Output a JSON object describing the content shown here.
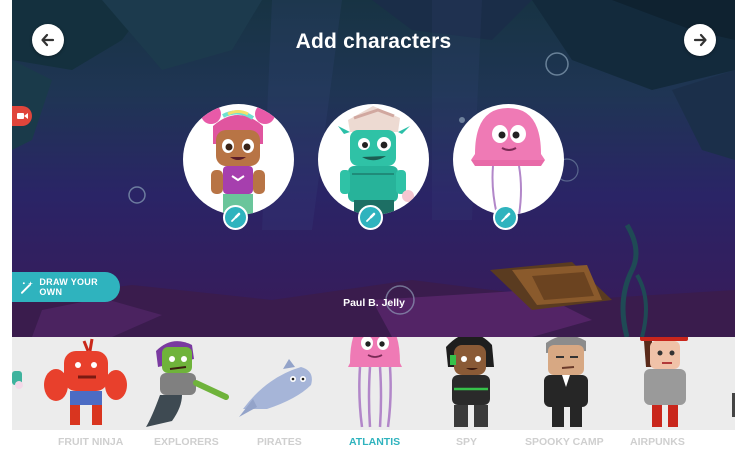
{
  "header": {
    "title": "Add characters",
    "back_icon": "arrow-left-icon",
    "forward_icon": "arrow-right-icon"
  },
  "slots": [
    {
      "character": "girl-with-pink-pigtails",
      "edit_icon": "paintbrush-icon"
    },
    {
      "character": "green-goblin-pirate",
      "edit_icon": "paintbrush-icon"
    },
    {
      "character": "pink-jellyfish",
      "edit_icon": "paintbrush-icon"
    }
  ],
  "draw_button": {
    "label": "DRAW YOUR OWN",
    "icon": "magic-wand-icon"
  },
  "selected_character": {
    "name": "Paul B. Jelly"
  },
  "record_icon": "video-camera-icon",
  "tray_characters": [
    "partial-character",
    "red-crab-monster",
    "green-zombie-mermaid",
    "blue-dolphin",
    "pink-jellyfish",
    "spy-girl-with-headset",
    "grey-haired-agent",
    "red-hat-detective"
  ],
  "categories": [
    {
      "label": "FRUIT NINJA",
      "active": false
    },
    {
      "label": "EXPLORERS",
      "active": false
    },
    {
      "label": "PIRATES",
      "active": false
    },
    {
      "label": "ATLANTIS",
      "active": true
    },
    {
      "label": "SPY",
      "active": false
    },
    {
      "label": "SPOOKY CAMP",
      "active": false
    },
    {
      "label": "AIRPUNKS",
      "active": false
    }
  ],
  "colors": {
    "accent": "#2fb3be",
    "record": "#e0453b",
    "tray_bg": "#ececec",
    "inactive_category": "#cfcfcf"
  }
}
